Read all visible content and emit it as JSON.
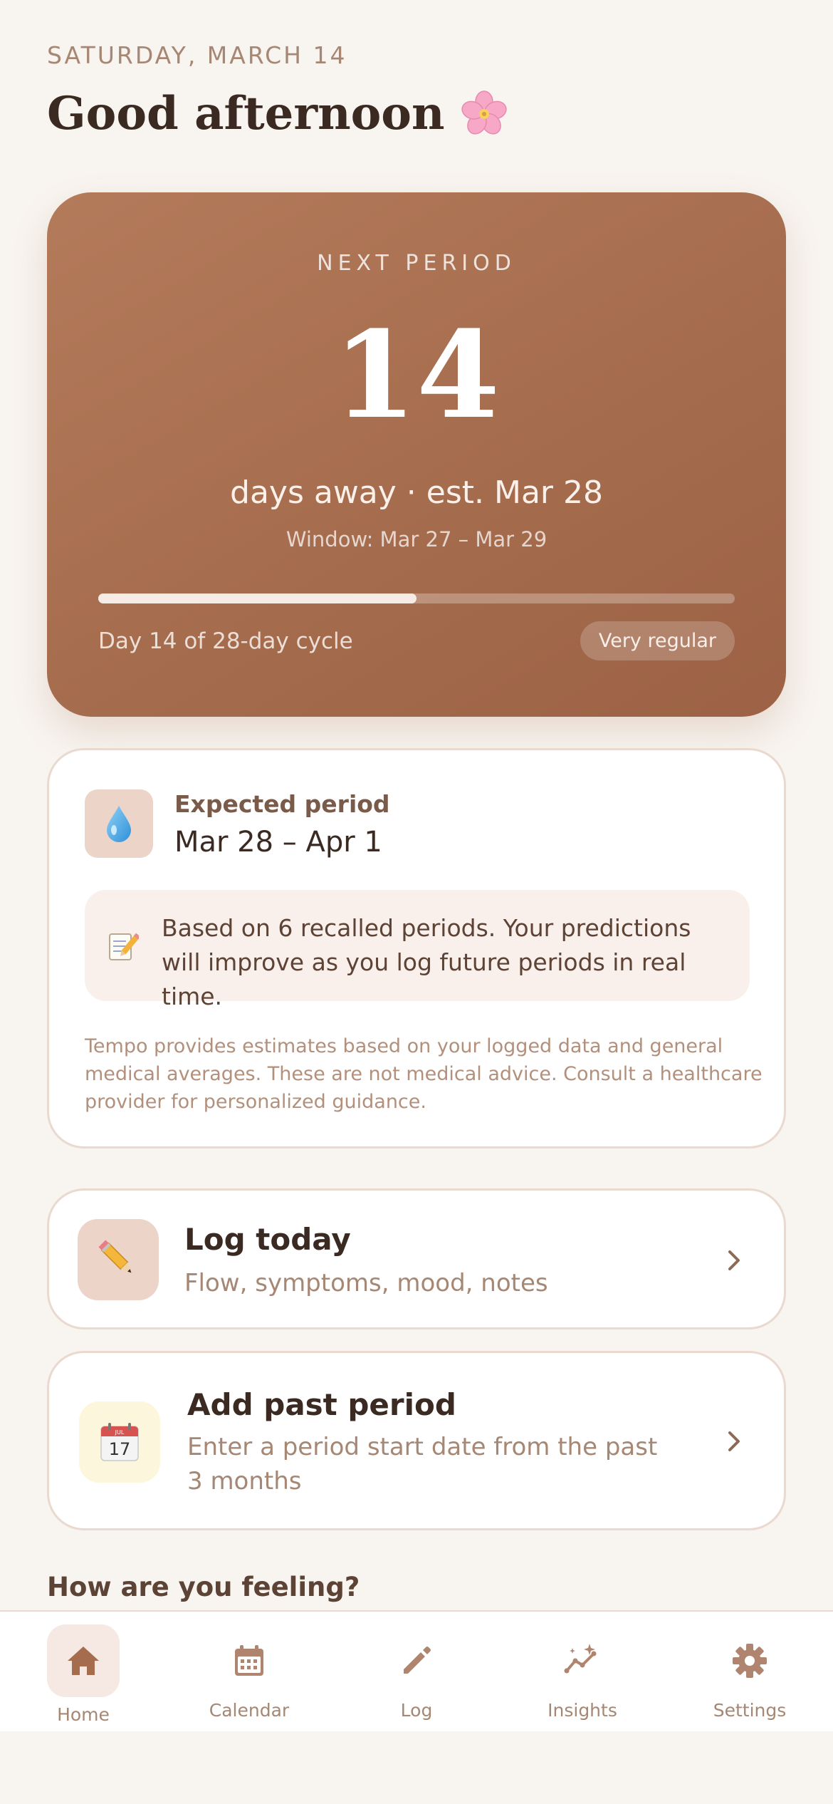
{
  "header": {
    "date": "SATURDAY, MARCH 14",
    "greeting": "Good afternoon",
    "greeting_icon": "cherry-blossom-icon"
  },
  "hero": {
    "label": "NEXT PERIOD",
    "days": "14",
    "subtitle": "days away · est. Mar 28",
    "window": "Window: Mar 27 – Mar 29",
    "progress": 0.5,
    "cycle_text": "Day 14 of 28-day cycle",
    "regularity_badge": "Very regular"
  },
  "expected": {
    "icon": "droplet-icon",
    "title": "Expected period",
    "range": "Mar 28 – Apr 1",
    "note_icon": "memo-icon",
    "note": "Based on 6 recalled periods. Your predictions will improve as you log future periods in real time.",
    "disclaimer": "Tempo provides estimates based on your logged data and general medical averages. These are not medical advice. Consult a healthcare provider for personalized guidance."
  },
  "log_today": {
    "icon": "pencil-icon",
    "title": "Log today",
    "subtitle": "Flow, symptoms, mood, notes"
  },
  "add_past": {
    "icon": "calendar-icon",
    "title": "Add past period",
    "subtitle": "Enter a period start date from the past 3 months",
    "calendar_month": "JUL",
    "calendar_day": "17"
  },
  "feeling_heading": "How are you feeling?",
  "tabbar": {
    "items": [
      {
        "label": "Home",
        "icon": "home-icon",
        "active": true
      },
      {
        "label": "Calendar",
        "icon": "calendar-icon",
        "active": false
      },
      {
        "label": "Log",
        "icon": "pencil-icon",
        "active": false
      },
      {
        "label": "Insights",
        "icon": "sparkle-chart-icon",
        "active": false
      },
      {
        "label": "Settings",
        "icon": "gear-icon",
        "active": false
      }
    ]
  },
  "colors": {
    "accent": "#a56c4d",
    "background": "#f8f4f0",
    "muted_text": "#a68773",
    "border": "#ead9cf"
  }
}
